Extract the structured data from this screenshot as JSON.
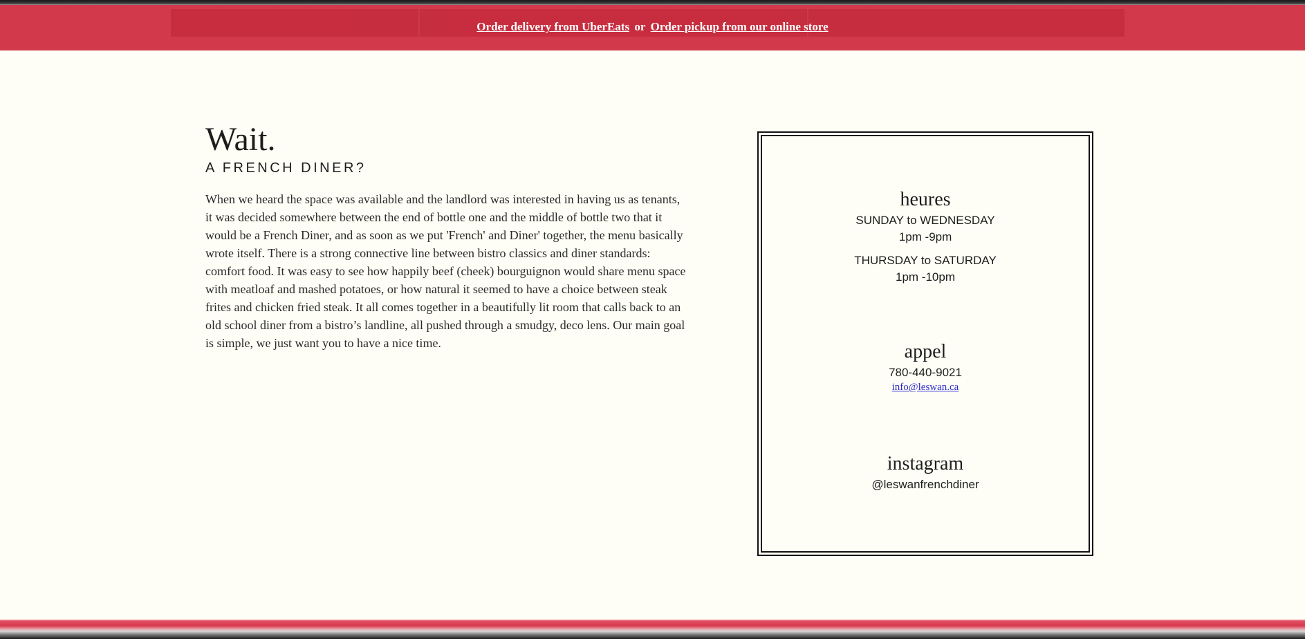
{
  "banner": {
    "link1": "Order delivery from UberEats",
    "or": "or",
    "link2": "Order pickup from our online store"
  },
  "intro": {
    "title": "Wait.",
    "subtitle": "A FRENCH DINER?",
    "body": "When we heard the space was available and the landlord was interested in having us as tenants, it was decided somewhere between the end of bottle one and the middle of bottle two that it would be a French Diner, and as soon as we put 'French' and Diner' together, the menu basically wrote itself. There is a strong connective line between bistro classics and diner standards: comfort food. It was easy to see how happily beef (cheek) bourguignon would share menu space with meatloaf and mashed potatoes, or how natural it seemed to have a choice between steak frites and chicken fried steak. It all comes together in a beautifully lit room that calls back to an old school diner from a bistro’s landline, all pushed through a smudgy, deco lens. Our main goal is simple, we just want you to have a nice time."
  },
  "hours": {
    "title": "heures",
    "line1_days": "SUNDAY to WEDNESDAY",
    "line1_time": "1pm -9pm",
    "line2_days": "THURSDAY to SATURDAY",
    "line2_time": "1pm -10pm"
  },
  "contact": {
    "title": "appel",
    "phone": "780-440-9021",
    "email": "info@leswan.ca"
  },
  "social": {
    "title": "instagram",
    "handle": "@leswanfrenchdiner"
  }
}
